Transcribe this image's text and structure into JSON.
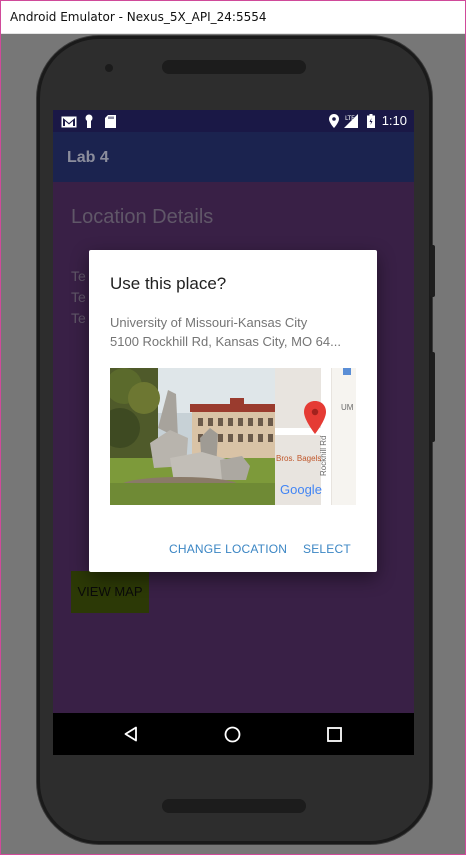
{
  "window": {
    "title": "Android Emulator - Nexus_5X_API_24:5554"
  },
  "status_bar": {
    "time": "1:10",
    "network": "LTE",
    "icons": [
      "gmail-icon",
      "notification-icon",
      "sd-card-icon",
      "location-icon",
      "signal-icon",
      "battery-icon"
    ]
  },
  "app_bar": {
    "title": "Lab 4"
  },
  "content": {
    "title": "Location Details",
    "text_rows": [
      "Te",
      "Te",
      "Te"
    ],
    "view_map_label": "VIEW MAP"
  },
  "dialog": {
    "title": "Use this place?",
    "place_name": "University of Missouri-Kansas City",
    "place_address": "5100 Rockhill Rd, Kansas City, MO 64...",
    "map_labels": {
      "road": "Rockhill Rd",
      "place": "Bros. Bagels",
      "edge_label": "UM",
      "brand": "Google"
    },
    "change_location_label": "CHANGE LOCATION",
    "select_label": "SELECT"
  },
  "colors": {
    "app_bar": "#283371",
    "status_bar": "#1a1846",
    "screen_bg": "#522f65",
    "view_map_button": "#3f5209",
    "dialog_button_text": "#3b86c4"
  }
}
